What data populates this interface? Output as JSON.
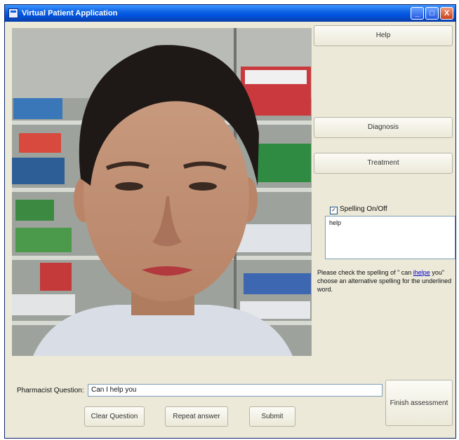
{
  "window": {
    "title": "Virtual Patient Application"
  },
  "title_controls": {
    "minimize": "_",
    "maximize": "□",
    "close": "X"
  },
  "buttons": {
    "help": "Help",
    "diagnosis": "Diagnosis",
    "treatment": "Treatment",
    "finish_assessment": "Finish assessment",
    "clear_question": "Clear Question",
    "repeat_answer": "Repeat answer",
    "submit": "Submit"
  },
  "spelling": {
    "toggle_label": "Spelling On/Off",
    "checked": true,
    "check_mark": "✓",
    "suggestion": "help",
    "message_before": "Please check the spelling of \" can ",
    "message_link": "ihelpe",
    "message_after": " you\" choose an alternative spelling for the underlined word."
  },
  "question": {
    "label": "Pharmacist Question:",
    "value": "Can I help you"
  },
  "colors": {
    "titlebar": "#0054e3",
    "window_bg": "#ece9d8",
    "link": "#0000cc"
  },
  "icons": {
    "window_icon": "app-window-icon",
    "minimize": "minimize-icon",
    "maximize": "maximize-icon",
    "close": "close-icon"
  }
}
